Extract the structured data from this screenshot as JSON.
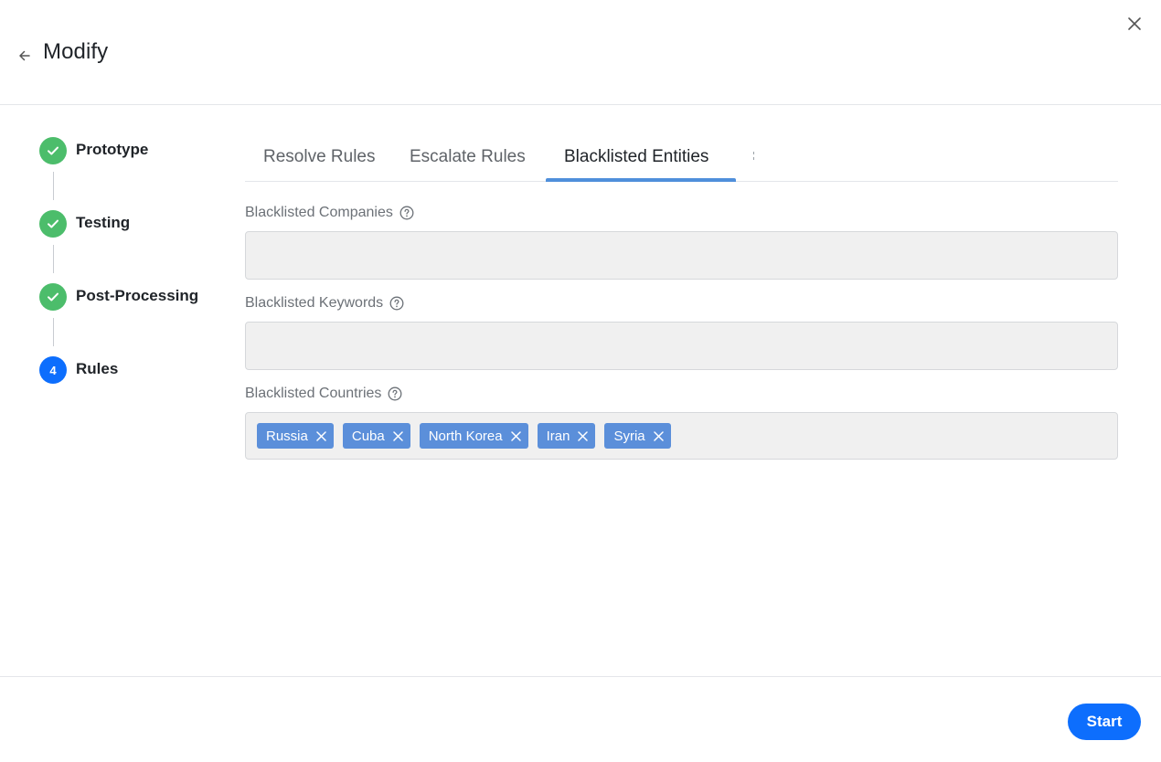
{
  "header": {
    "title": "Modify",
    "back_icon": "arrow-left-icon",
    "close_icon": "close-icon"
  },
  "steps": [
    {
      "label": "Prototype",
      "status": "done",
      "icon": "check-icon"
    },
    {
      "label": "Testing",
      "status": "done",
      "icon": "check-icon"
    },
    {
      "label": "Post-Processing",
      "status": "done",
      "icon": "check-icon"
    },
    {
      "label": "Rules",
      "status": "current",
      "number": "4"
    }
  ],
  "tabs": [
    {
      "label": "Resolve Rules",
      "active": false
    },
    {
      "label": "Escalate Rules",
      "active": false
    },
    {
      "label": "Blacklisted Entities",
      "active": true
    }
  ],
  "fields": {
    "companies": {
      "label": "Blacklisted Companies",
      "value": ""
    },
    "keywords": {
      "label": "Blacklisted Keywords",
      "value": ""
    },
    "countries": {
      "label": "Blacklisted Countries",
      "chips": [
        "Russia",
        "Cuba",
        "North Korea",
        "Iran",
        "Syria"
      ]
    }
  },
  "footer": {
    "start_label": "Start"
  },
  "colors": {
    "primary": "#0d6efd",
    "success": "#4cbd6b",
    "chip": "#5b8fda",
    "tab_indicator": "#4f8fdb",
    "field_bg": "#f0f0f0"
  }
}
